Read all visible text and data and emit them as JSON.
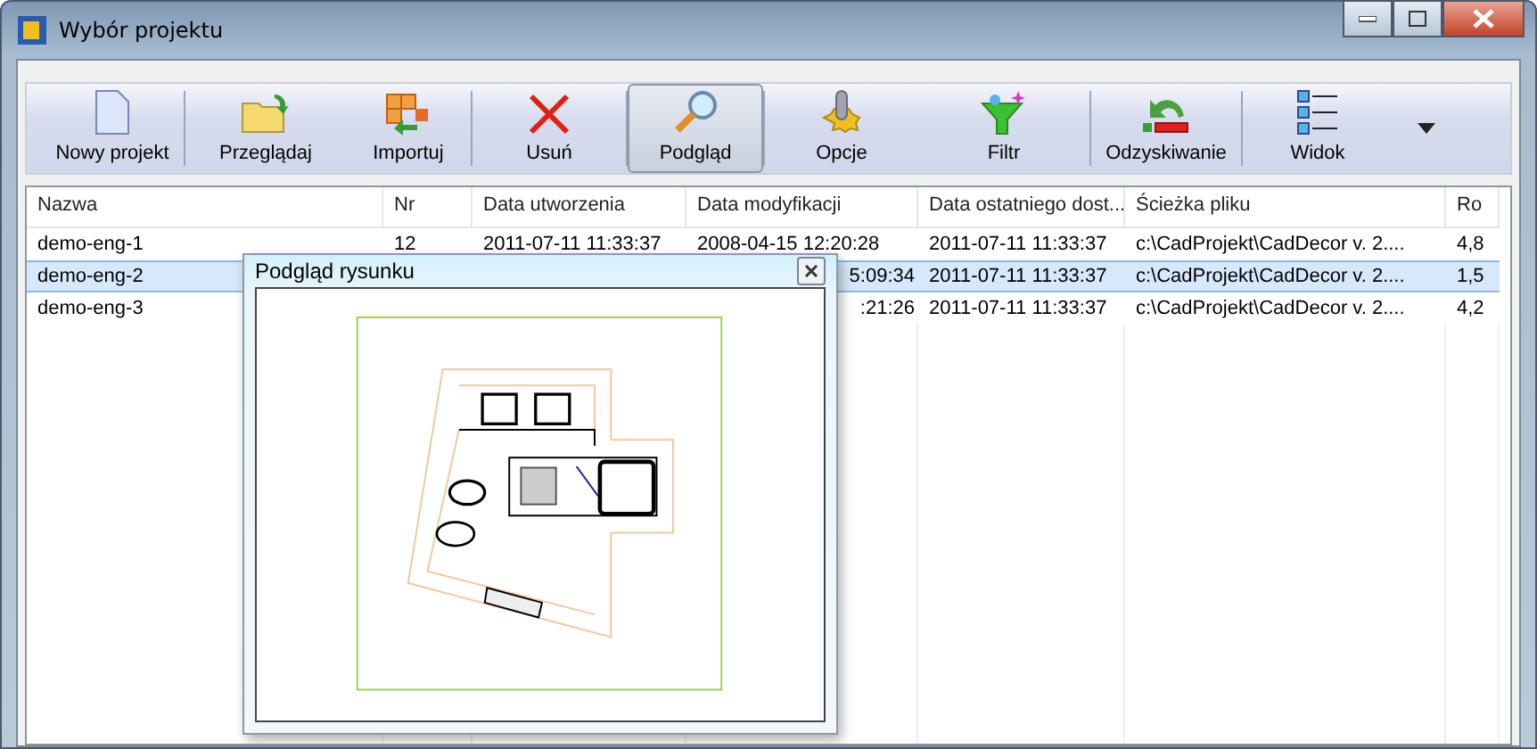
{
  "window": {
    "title": "Wybór projektu"
  },
  "toolbar": [
    {
      "label": "Nowy projekt",
      "kind": "new",
      "selected": false
    },
    {
      "label": "Przeglądaj",
      "kind": "browse",
      "selected": false
    },
    {
      "label": "Importuj",
      "kind": "import",
      "selected": false
    },
    {
      "label": "Usuń",
      "kind": "delete",
      "selected": false
    },
    {
      "label": "Podgląd",
      "kind": "preview",
      "selected": true
    },
    {
      "label": "Opcje",
      "kind": "options",
      "selected": false
    },
    {
      "label": "Filtr",
      "kind": "filter",
      "selected": false
    },
    {
      "label": "Odzyskiwanie",
      "kind": "recover",
      "selected": false
    },
    {
      "label": "Widok",
      "kind": "view",
      "selected": false
    }
  ],
  "table": {
    "columns": [
      "Nazwa",
      "Nr",
      "Data utworzenia",
      "Data modyfikacji",
      "Data ostatniego dost...",
      "Ścieżka pliku",
      "Ro"
    ],
    "rows": [
      {
        "selected": false,
        "cells": [
          {
            "text": "demo-eng-1"
          },
          {
            "text": "12"
          },
          {
            "text": "2011-07-11 11:33:37"
          },
          {
            "text": "2008-04-15 12:20:28"
          },
          {
            "text": "2011-07-11 11:33:37"
          },
          {
            "text": "c:\\CadProjekt\\CadDecor v. 2...."
          },
          {
            "text": "4,8"
          }
        ]
      },
      {
        "selected": true,
        "cells": [
          {
            "text": "demo-eng-2"
          },
          null,
          null,
          {
            "text": "5:09:34",
            "partial": true
          },
          {
            "text": "2011-07-11 11:33:37"
          },
          {
            "text": "c:\\CadProjekt\\CadDecor v. 2...."
          },
          {
            "text": "1,5"
          }
        ]
      },
      {
        "selected": false,
        "cells": [
          {
            "text": "demo-eng-3"
          },
          null,
          null,
          {
            "text": ":21:26",
            "partial": true
          },
          {
            "text": "2011-07-11 11:33:37"
          },
          {
            "text": "c:\\CadProjekt\\CadDecor v. 2...."
          },
          {
            "text": "4,2"
          }
        ]
      }
    ]
  },
  "preview": {
    "title": "Podgląd rysunku"
  }
}
